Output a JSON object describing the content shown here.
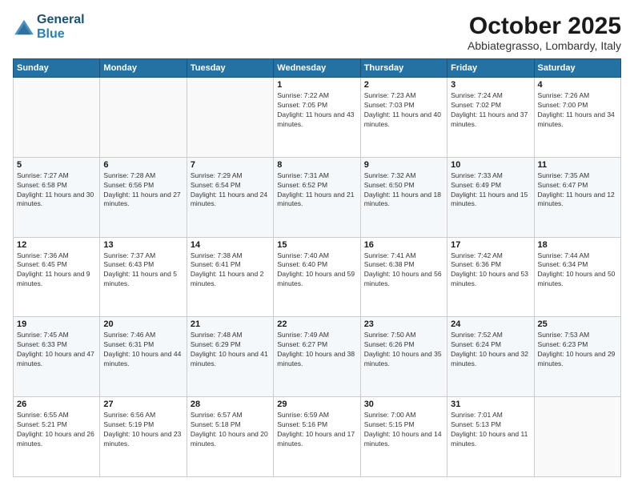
{
  "header": {
    "logo_line1": "General",
    "logo_line2": "Blue",
    "month": "October 2025",
    "location": "Abbiategrasso, Lombardy, Italy"
  },
  "weekdays": [
    "Sunday",
    "Monday",
    "Tuesday",
    "Wednesday",
    "Thursday",
    "Friday",
    "Saturday"
  ],
  "weeks": [
    [
      {
        "day": "",
        "sunrise": "",
        "sunset": "",
        "daylight": ""
      },
      {
        "day": "",
        "sunrise": "",
        "sunset": "",
        "daylight": ""
      },
      {
        "day": "",
        "sunrise": "",
        "sunset": "",
        "daylight": ""
      },
      {
        "day": "1",
        "sunrise": "Sunrise: 7:22 AM",
        "sunset": "Sunset: 7:05 PM",
        "daylight": "Daylight: 11 hours and 43 minutes."
      },
      {
        "day": "2",
        "sunrise": "Sunrise: 7:23 AM",
        "sunset": "Sunset: 7:03 PM",
        "daylight": "Daylight: 11 hours and 40 minutes."
      },
      {
        "day": "3",
        "sunrise": "Sunrise: 7:24 AM",
        "sunset": "Sunset: 7:02 PM",
        "daylight": "Daylight: 11 hours and 37 minutes."
      },
      {
        "day": "4",
        "sunrise": "Sunrise: 7:26 AM",
        "sunset": "Sunset: 7:00 PM",
        "daylight": "Daylight: 11 hours and 34 minutes."
      }
    ],
    [
      {
        "day": "5",
        "sunrise": "Sunrise: 7:27 AM",
        "sunset": "Sunset: 6:58 PM",
        "daylight": "Daylight: 11 hours and 30 minutes."
      },
      {
        "day": "6",
        "sunrise": "Sunrise: 7:28 AM",
        "sunset": "Sunset: 6:56 PM",
        "daylight": "Daylight: 11 hours and 27 minutes."
      },
      {
        "day": "7",
        "sunrise": "Sunrise: 7:29 AM",
        "sunset": "Sunset: 6:54 PM",
        "daylight": "Daylight: 11 hours and 24 minutes."
      },
      {
        "day": "8",
        "sunrise": "Sunrise: 7:31 AM",
        "sunset": "Sunset: 6:52 PM",
        "daylight": "Daylight: 11 hours and 21 minutes."
      },
      {
        "day": "9",
        "sunrise": "Sunrise: 7:32 AM",
        "sunset": "Sunset: 6:50 PM",
        "daylight": "Daylight: 11 hours and 18 minutes."
      },
      {
        "day": "10",
        "sunrise": "Sunrise: 7:33 AM",
        "sunset": "Sunset: 6:49 PM",
        "daylight": "Daylight: 11 hours and 15 minutes."
      },
      {
        "day": "11",
        "sunrise": "Sunrise: 7:35 AM",
        "sunset": "Sunset: 6:47 PM",
        "daylight": "Daylight: 11 hours and 12 minutes."
      }
    ],
    [
      {
        "day": "12",
        "sunrise": "Sunrise: 7:36 AM",
        "sunset": "Sunset: 6:45 PM",
        "daylight": "Daylight: 11 hours and 9 minutes."
      },
      {
        "day": "13",
        "sunrise": "Sunrise: 7:37 AM",
        "sunset": "Sunset: 6:43 PM",
        "daylight": "Daylight: 11 hours and 5 minutes."
      },
      {
        "day": "14",
        "sunrise": "Sunrise: 7:38 AM",
        "sunset": "Sunset: 6:41 PM",
        "daylight": "Daylight: 11 hours and 2 minutes."
      },
      {
        "day": "15",
        "sunrise": "Sunrise: 7:40 AM",
        "sunset": "Sunset: 6:40 PM",
        "daylight": "Daylight: 10 hours and 59 minutes."
      },
      {
        "day": "16",
        "sunrise": "Sunrise: 7:41 AM",
        "sunset": "Sunset: 6:38 PM",
        "daylight": "Daylight: 10 hours and 56 minutes."
      },
      {
        "day": "17",
        "sunrise": "Sunrise: 7:42 AM",
        "sunset": "Sunset: 6:36 PM",
        "daylight": "Daylight: 10 hours and 53 minutes."
      },
      {
        "day": "18",
        "sunrise": "Sunrise: 7:44 AM",
        "sunset": "Sunset: 6:34 PM",
        "daylight": "Daylight: 10 hours and 50 minutes."
      }
    ],
    [
      {
        "day": "19",
        "sunrise": "Sunrise: 7:45 AM",
        "sunset": "Sunset: 6:33 PM",
        "daylight": "Daylight: 10 hours and 47 minutes."
      },
      {
        "day": "20",
        "sunrise": "Sunrise: 7:46 AM",
        "sunset": "Sunset: 6:31 PM",
        "daylight": "Daylight: 10 hours and 44 minutes."
      },
      {
        "day": "21",
        "sunrise": "Sunrise: 7:48 AM",
        "sunset": "Sunset: 6:29 PM",
        "daylight": "Daylight: 10 hours and 41 minutes."
      },
      {
        "day": "22",
        "sunrise": "Sunrise: 7:49 AM",
        "sunset": "Sunset: 6:27 PM",
        "daylight": "Daylight: 10 hours and 38 minutes."
      },
      {
        "day": "23",
        "sunrise": "Sunrise: 7:50 AM",
        "sunset": "Sunset: 6:26 PM",
        "daylight": "Daylight: 10 hours and 35 minutes."
      },
      {
        "day": "24",
        "sunrise": "Sunrise: 7:52 AM",
        "sunset": "Sunset: 6:24 PM",
        "daylight": "Daylight: 10 hours and 32 minutes."
      },
      {
        "day": "25",
        "sunrise": "Sunrise: 7:53 AM",
        "sunset": "Sunset: 6:23 PM",
        "daylight": "Daylight: 10 hours and 29 minutes."
      }
    ],
    [
      {
        "day": "26",
        "sunrise": "Sunrise: 6:55 AM",
        "sunset": "Sunset: 5:21 PM",
        "daylight": "Daylight: 10 hours and 26 minutes."
      },
      {
        "day": "27",
        "sunrise": "Sunrise: 6:56 AM",
        "sunset": "Sunset: 5:19 PM",
        "daylight": "Daylight: 10 hours and 23 minutes."
      },
      {
        "day": "28",
        "sunrise": "Sunrise: 6:57 AM",
        "sunset": "Sunset: 5:18 PM",
        "daylight": "Daylight: 10 hours and 20 minutes."
      },
      {
        "day": "29",
        "sunrise": "Sunrise: 6:59 AM",
        "sunset": "Sunset: 5:16 PM",
        "daylight": "Daylight: 10 hours and 17 minutes."
      },
      {
        "day": "30",
        "sunrise": "Sunrise: 7:00 AM",
        "sunset": "Sunset: 5:15 PM",
        "daylight": "Daylight: 10 hours and 14 minutes."
      },
      {
        "day": "31",
        "sunrise": "Sunrise: 7:01 AM",
        "sunset": "Sunset: 5:13 PM",
        "daylight": "Daylight: 10 hours and 11 minutes."
      },
      {
        "day": "",
        "sunrise": "",
        "sunset": "",
        "daylight": ""
      }
    ]
  ]
}
